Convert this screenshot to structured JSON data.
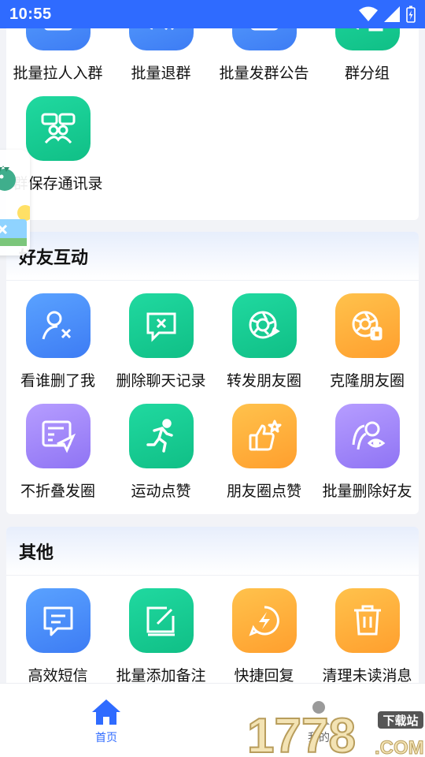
{
  "status_bar": {
    "time": "10:55"
  },
  "group_section": {
    "row1": [
      {
        "label": "批量拉人入群",
        "color": "blue",
        "icon": "group-add-icon"
      },
      {
        "label": "批量退群",
        "color": "blue",
        "icon": "group-exit-icon"
      },
      {
        "label": "批量发群公告",
        "color": "blue",
        "icon": "announcement-icon"
      },
      {
        "label": "群分组",
        "color": "green",
        "icon": "group-category-icon"
      }
    ],
    "row2": [
      {
        "label": "群保存通讯录",
        "color": "green",
        "icon": "contacts-save-icon"
      }
    ]
  },
  "friends_section": {
    "title": "好友互动",
    "items": [
      {
        "label": "看谁删了我",
        "color": "blue",
        "icon": "user-deleted-icon"
      },
      {
        "label": "删除聊天记录",
        "color": "green",
        "icon": "delete-chat-icon"
      },
      {
        "label": "转发朋友圈",
        "color": "green",
        "icon": "forward-moments-icon"
      },
      {
        "label": "克隆朋友圈",
        "color": "orange",
        "icon": "clone-moments-icon"
      },
      {
        "label": "不折叠发圈",
        "color": "purple",
        "icon": "send-moments-icon"
      },
      {
        "label": "运动点赞",
        "color": "green",
        "icon": "running-icon"
      },
      {
        "label": "朋友圈点赞",
        "color": "orange",
        "icon": "thumbs-up-icon"
      },
      {
        "label": "批量删除好友",
        "color": "purple",
        "icon": "remove-friends-icon"
      }
    ]
  },
  "other_section": {
    "title": "其他",
    "items": [
      {
        "label": "高效短信",
        "color": "blue",
        "icon": "sms-icon"
      },
      {
        "label": "批量添加备注",
        "color": "green",
        "icon": "edit-note-icon"
      },
      {
        "label": "快捷回复",
        "color": "orange",
        "icon": "quick-reply-icon"
      },
      {
        "label": "清理未读消息",
        "color": "orange",
        "icon": "trash-icon"
      }
    ]
  },
  "bottom_nav": {
    "home_label": "首页",
    "mine_label": "我的"
  },
  "watermark": {
    "main": "1778",
    "sub": ".COM",
    "tag": "下载站"
  },
  "colors": {
    "accent": "#2f6bff",
    "blue": "#4a8cff",
    "green": "#16c98f",
    "orange": "#ffad3a",
    "purple": "#a287fb"
  }
}
